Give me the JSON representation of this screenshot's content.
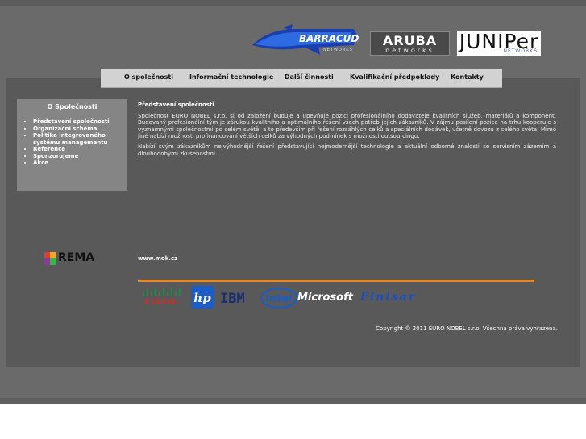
{
  "header": {
    "logos": [
      {
        "name": "barracuda",
        "text": "BARRACUDA",
        "subtext": "NETWORKS"
      },
      {
        "name": "aruba",
        "text": "ARUBA",
        "subtext": "networks"
      },
      {
        "name": "juniper",
        "text": "JUNIPer",
        "subtext": "NETWORKS"
      }
    ]
  },
  "nav": {
    "items": [
      {
        "label": "O společnosti"
      },
      {
        "label": "Informační technologie"
      },
      {
        "label": "Další činnosti"
      },
      {
        "label": "Kvalifikační předpoklady"
      },
      {
        "label": "Kontakty"
      }
    ]
  },
  "sidebar": {
    "title": "O Společnosti",
    "items": [
      {
        "label": "Představení společnosti"
      },
      {
        "label": "Organizační schéma"
      },
      {
        "label": "Politika integrovaného systému managementu"
      },
      {
        "label": "Reference"
      },
      {
        "label": "Sponzorujeme"
      },
      {
        "label": "Akce"
      }
    ]
  },
  "article": {
    "heading": "Představení společnosti",
    "paragraphs": [
      "Společnost EURO NOBEL s.r.o. si od založení buduje a upevňuje pozici profesionálního dodavatele kvalitních služeb, materiálů a komponent. Budovaný profesionální tým je zárukou kvalitního a optimálního řešení všech potřeb jejich zákazníků. V zájmu posílení pozice na trhu kooperuje s významnými společnostmi po celém světě, a to především při řešení rozsáhlých celků a speciálních dodávek, včetně dovozu z celého světa. Mimo jiné nabízí možnosti profinancování větších celků za výhodných podmínek s možností outsourcingu.",
      "Nabízí svým zákazníkům nejvýhodnější řešení představující nejmodernější technologie a aktuální odborné znalosti se servisním zázemím a dlouhodobými zkušenostmi."
    ]
  },
  "footer": {
    "rema_label": "REMA",
    "www_link": "www.mok.cz",
    "partners": [
      {
        "name": "cisco",
        "text": "CISCO."
      },
      {
        "name": "hp",
        "text": "hp"
      },
      {
        "name": "ibm",
        "text": "IBM"
      },
      {
        "name": "intel",
        "text": "intel"
      },
      {
        "name": "microsoft",
        "text": "Microsoft"
      },
      {
        "name": "finisar",
        "text": "Finisar"
      }
    ],
    "copyright": "Copyright © 2011 EURO NOBEL s.r.o. Všechna práva vyhrazena."
  },
  "colors": {
    "background": "#6a6a6a",
    "panel": "#595959",
    "nav_bar": "#d2d2d2",
    "sidebar": "#858585",
    "divider": "#e08a2a",
    "cisco_red": "#d72828",
    "ibm_blue": "#1c2e6e",
    "hp_blue": "#1a5cc8",
    "finisar_blue": "#1a4fc4"
  }
}
